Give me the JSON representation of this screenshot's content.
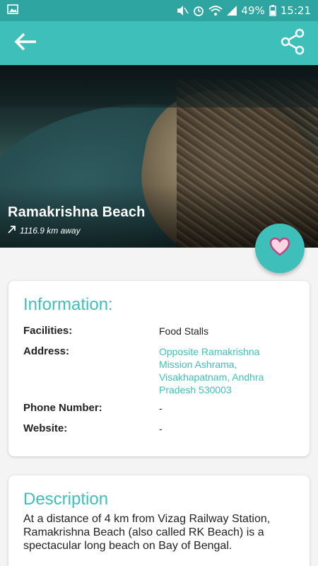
{
  "status_bar": {
    "battery": "49%",
    "time": "15:21",
    "icons": [
      "image-icon",
      "mute-icon",
      "alarm-icon",
      "wifi-icon",
      "signal-icon",
      "battery-icon"
    ]
  },
  "app_bar": {
    "back_icon": "arrow-left-icon",
    "share_icon": "share-icon"
  },
  "hero": {
    "title": "Ramakrishna Beach",
    "distance": "1116.9 km away",
    "distance_icon": "arrow-up-right-icon"
  },
  "favorite": {
    "icon": "heart-icon"
  },
  "information": {
    "heading": "Information:",
    "rows": [
      {
        "label": "Facilities:",
        "value": "Food Stalls"
      },
      {
        "label": "Address:",
        "value": "Opposite Ramakrishna Mission Ashrama, Visakhapatnam, Andhra Pradesh 530003"
      },
      {
        "label": "Phone Number:",
        "value": "-"
      },
      {
        "label": "Website:",
        "value": "-"
      }
    ]
  },
  "description": {
    "heading": "Description",
    "text": "At a distance of 4 km from Vizag Railway Station, Ramakrishna Beach (also called RK Beach) is a spectacular long beach on Bay of Bengal."
  },
  "colors": {
    "accent": "#3ebfba",
    "status_bar": "#2fa5a1",
    "heart": "#c2457f"
  }
}
